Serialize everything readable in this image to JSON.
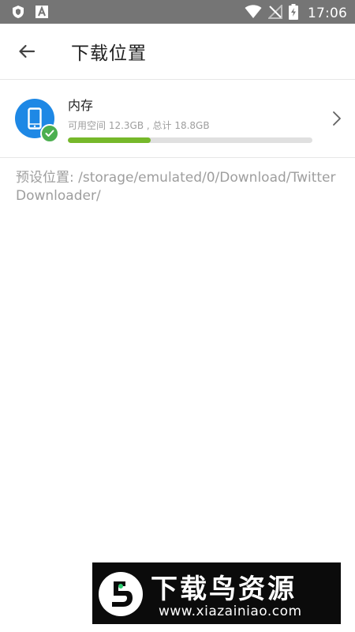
{
  "status_bar": {
    "time": "17:06",
    "left_icons": [
      "shield-icon",
      "font-a-icon"
    ],
    "right_icons": [
      "wifi-icon",
      "no-sim-icon",
      "battery-charging-icon"
    ]
  },
  "app_bar": {
    "back_icon": "arrow-left-icon",
    "title": "下载位置"
  },
  "storage": {
    "name": "内存",
    "detail": "可用空间 12.3GB , 总计 18.8GB",
    "used_fraction": 0.34,
    "icon": "phone-icon",
    "selected": true,
    "accent_color": "#1e88e5",
    "progress_color": "#76b82a",
    "check_color": "#4caf50"
  },
  "default_path": {
    "text": "预设位置: /storage/emulated/0/Download/TwitterDownloader/"
  },
  "watermark": {
    "title": "下载鸟资源",
    "url": "www.xiazainiao.com"
  }
}
